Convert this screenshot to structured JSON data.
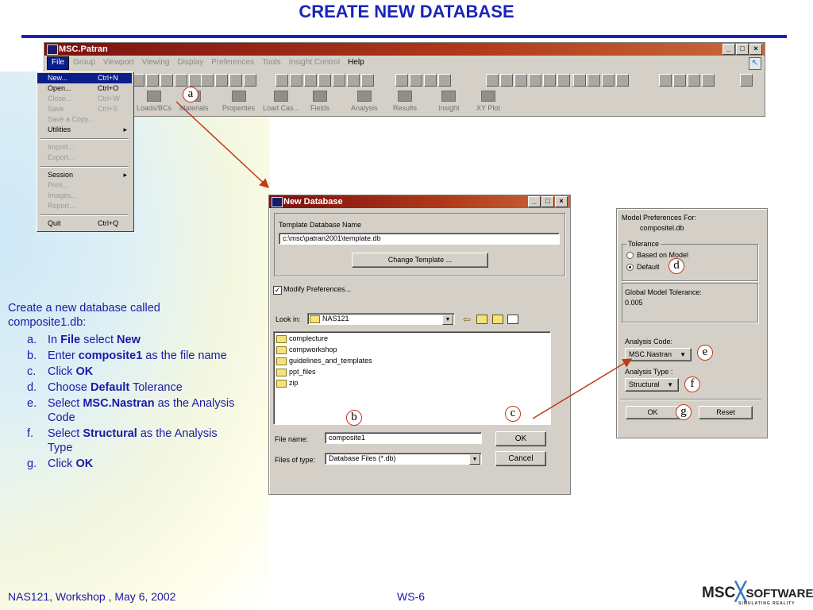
{
  "slide": {
    "title": "CREATE NEW DATABASE",
    "footer_left": "NAS121, Workshop , May 6, 2002",
    "footer_mid": "WS-6",
    "logo_main": "MSC",
    "logo_right": "SOFTWARE",
    "logo_sub": "SIMULATING REALITY"
  },
  "instructions": {
    "intro": "Create a new database called composite1.db:",
    "steps": [
      {
        "n": "a.",
        "pre": "In ",
        "b1": "File",
        "mid": " select ",
        "b2": "New",
        "post": ""
      },
      {
        "n": "b.",
        "pre": "Enter ",
        "b1": "composite1",
        "mid": " as the file name",
        "b2": "",
        "post": ""
      },
      {
        "n": "c.",
        "pre": "Click ",
        "b1": "OK",
        "mid": "",
        "b2": "",
        "post": ""
      },
      {
        "n": "d.",
        "pre": "Choose ",
        "b1": "Default",
        "mid": " Tolerance",
        "b2": "",
        "post": ""
      },
      {
        "n": "e.",
        "pre": "Select ",
        "b1": "MSC.Nastran",
        "mid": " as the Analysis Code",
        "b2": "",
        "post": ""
      },
      {
        "n": "f.",
        "pre": "Select ",
        "b1": "Structural",
        "mid": " as the Analysis Type",
        "b2": "",
        "post": ""
      },
      {
        "n": "g.",
        "pre": "Click ",
        "b1": "OK",
        "mid": "",
        "b2": "",
        "post": ""
      }
    ]
  },
  "labels": {
    "a": "a",
    "b": "b",
    "c": "c",
    "d": "d",
    "e": "e",
    "f": "f",
    "g": "g"
  },
  "patran": {
    "title": "MSC.Patran",
    "menus": [
      "File",
      "Group",
      "Viewport",
      "Viewing",
      "Display",
      "Preferences",
      "Tools",
      "Insight Control",
      "Help"
    ],
    "apps": [
      "Loads/BCs",
      "Materials",
      "Properties",
      "Load Cas...",
      "Fields",
      "Analysis",
      "Results",
      "Insight",
      "XY Plot"
    ]
  },
  "file_menu": {
    "items": [
      {
        "label": "New...",
        "shortcut": "Ctrl+N"
      },
      {
        "label": "Open...",
        "shortcut": "Ctrl+O"
      },
      {
        "label": "Close...",
        "shortcut": "Ctrl+W"
      },
      {
        "label": "Save",
        "shortcut": "Ctrl+S"
      },
      {
        "label": "Save a Copy...",
        "shortcut": ""
      },
      {
        "label": "Utilities",
        "shortcut": ""
      },
      {
        "label": "Import...",
        "shortcut": ""
      },
      {
        "label": "Export...",
        "shortcut": ""
      },
      {
        "label": "Session",
        "shortcut": ""
      },
      {
        "label": "Print...",
        "shortcut": ""
      },
      {
        "label": "Images...",
        "shortcut": ""
      },
      {
        "label": "Report...",
        "shortcut": ""
      },
      {
        "label": "Quit",
        "shortcut": "Ctrl+Q"
      }
    ]
  },
  "new_db": {
    "title": "New Database",
    "template_label": "Template Database Name",
    "template_value": "c:\\msc\\patran2001\\template.db",
    "change_template": "Change Template ...",
    "modify_prefs": "Modify Preferences...",
    "look_in_label": "Look in:",
    "look_in_value": "NAS121",
    "folders": [
      "complecture",
      "compworkshop",
      "guidelines_and_templates",
      "ppt_files",
      "zip"
    ],
    "file_name_label": "File name:",
    "file_name_value": "composite1",
    "files_type_label": "Files of type:",
    "files_type_value": "Database Files (*.db)",
    "ok": "OK",
    "cancel": "Cancel"
  },
  "model_prefs": {
    "title": "Model Preferences For:",
    "db_name": "compositel.db",
    "tolerance_label": "Tolerance",
    "opt_based": "Based on Model",
    "opt_default": "Default",
    "global_tol_label": "Global Model Tolerance:",
    "global_tol_value": "0.005",
    "analysis_code_label": "Analysis Code:",
    "analysis_code_value": "MSC.Nastran",
    "analysis_type_label": "Analysis Type :",
    "analysis_type_value": "Structural",
    "ok": "OK",
    "reset": "Reset"
  },
  "colors": {
    "title": "#1a24b8",
    "arrow": "#c0391b",
    "selection": "#0a1e8a"
  }
}
